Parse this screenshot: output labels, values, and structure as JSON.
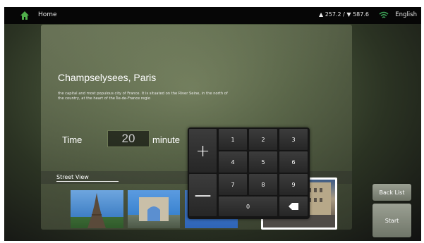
{
  "topbar": {
    "home_label": "Home",
    "status": "▲ 257.2 / ▼ 587.6",
    "language": "English"
  },
  "place": {
    "title": "Champselysees, Paris",
    "description": "the capital and most populous city of France. It is situated on the River Seine, in the north of the country, at the heart of the Île-de-France regio"
  },
  "time": {
    "label": "Time",
    "value": "20",
    "unit": "minute"
  },
  "street_view": {
    "label": "Street View"
  },
  "numpad": {
    "plus": "+",
    "minus": "—",
    "keys": [
      "1",
      "2",
      "3",
      "4",
      "5",
      "6",
      "7",
      "8",
      "9"
    ],
    "zero": "0"
  },
  "buttons": {
    "back_list": "Back List",
    "start": "Start"
  },
  "colors": {
    "accent_green": "#4fb04a",
    "panel": "#8a9470"
  }
}
